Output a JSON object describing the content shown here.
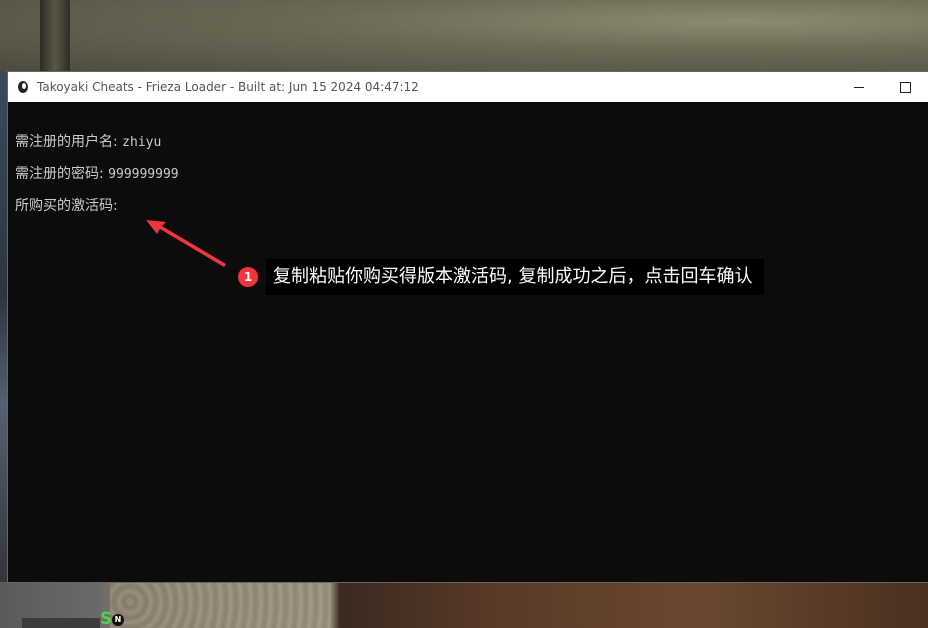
{
  "window": {
    "title": "Takoyaki Cheats - Frieza Loader - Built at:  Jun 15 2024 04:47:12"
  },
  "console": {
    "username_label": "需注册的用户名: ",
    "username_value": "zhiyu",
    "password_label": "需注册的密码: ",
    "password_value": "999999999",
    "activation_label": "所购买的激活码: "
  },
  "annotation": {
    "step": "1",
    "text": "复制粘贴你购买得版本激活码, 复制成功之后，点击回车确认",
    "color": "#f0353c"
  },
  "hud": {
    "s_label": "S",
    "n_label": "N"
  }
}
